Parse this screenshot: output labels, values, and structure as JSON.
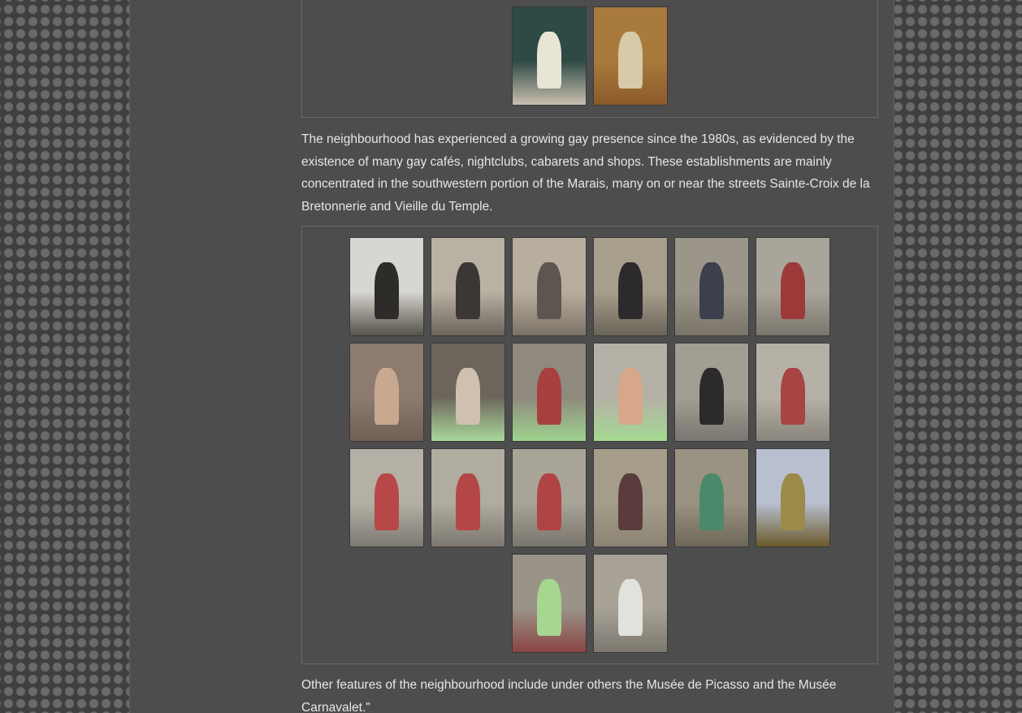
{
  "article": {
    "paragraph_1": "The neighbourhood has experienced a growing gay presence since the 1980s, as evidenced by the existence of many gay cafés, nightclubs, cabarets and shops. These establishments are mainly concentrated in the southwestern portion of the Marais, many on or near the streets Sainte-Croix de la Bretonnerie and Vieille du Temple.",
    "paragraph_2": "Other features of the neighbourhood include under others the Musée de Picasso and the Musée Carnavalet.\""
  },
  "colors": {
    "page_background": "#3f3f3f",
    "content_column": "#4d4d4d",
    "gallery_border": "#6b6b6b",
    "text": "#e6e6e6"
  },
  "gallery_top": {
    "thumbnails": [
      {
        "name": "pierrot-statue-thumbnail",
        "bg": "#2f4a45",
        "fg": "#e8e4d6",
        "floor": "#c9bfb0"
      },
      {
        "name": "harlequin-painting-thumbnail",
        "bg": "#a87a3c",
        "fg": "#d8c9a8",
        "floor": "#8c5a2a"
      }
    ]
  },
  "gallery_main": {
    "rows": [
      [
        {
          "name": "courtyard-photo-thumbnail",
          "bg": "#d8d6d0",
          "fg": "#2e2c2a",
          "floor": "#56524c"
        },
        {
          "name": "courtyard-photo-thumbnail",
          "bg": "#b9b1a3",
          "fg": "#3b3734",
          "floor": "#6d655c"
        },
        {
          "name": "courtyard-photo-thumbnail",
          "bg": "#b7ae9e",
          "fg": "#5c5550",
          "floor": "#7c7368"
        },
        {
          "name": "stained-window-photo-thumbnail",
          "bg": "#a79e8c",
          "fg": "#2c2a2c",
          "floor": "#6a6458"
        },
        {
          "name": "courtyard-photo-thumbnail",
          "bg": "#9c958a",
          "fg": "#3c3f4c",
          "floor": "#7a7468"
        },
        {
          "name": "girls-photo-thumbnail",
          "bg": "#aaa59a",
          "fg": "#9c3a3a",
          "floor": "#7b766c"
        }
      ],
      [
        {
          "name": "portrait-photo-thumbnail",
          "bg": "#8c7b6e",
          "fg": "#c9a890",
          "floor": "#6f5f55"
        },
        {
          "name": "portrait-photo-thumbnail",
          "bg": "#6d655c",
          "fg": "#cfc0b0",
          "floor": "#a8d89a"
        },
        {
          "name": "portrait-photo-thumbnail",
          "bg": "#8f897e",
          "fg": "#a84040",
          "floor": "#9ed38e"
        },
        {
          "name": "portrait-photo-thumbnail",
          "bg": "#b5b0a6",
          "fg": "#d6a889",
          "floor": "#a4da92"
        },
        {
          "name": "courtyard-photo-thumbnail",
          "bg": "#a39e94",
          "fg": "#2c2a2a",
          "floor": "#7a7670"
        },
        {
          "name": "girls-photo-thumbnail",
          "bg": "#b5b1a6",
          "fg": "#a84444",
          "floor": "#8a857c"
        }
      ],
      [
        {
          "name": "girls-photo-thumbnail",
          "bg": "#b4b0a5",
          "fg": "#b84848",
          "floor": "#7e7a72"
        },
        {
          "name": "girls-photo-thumbnail",
          "bg": "#b0aca0",
          "fg": "#b54646",
          "floor": "#7d786f"
        },
        {
          "name": "girls-photo-thumbnail",
          "bg": "#a9a498",
          "fg": "#b04444",
          "floor": "#7a756c"
        },
        {
          "name": "facade-photo-thumbnail",
          "bg": "#a59c8a",
          "fg": "#5a3c3c",
          "floor": "#8c8474"
        },
        {
          "name": "facade-photo-thumbnail",
          "bg": "#9a9282",
          "fg": "#4a8a6a",
          "floor": "#6e6858"
        },
        {
          "name": "building-sky-photo-thumbnail",
          "bg": "#b8c0d0",
          "fg": "#9c8a4a",
          "floor": "#6c5a2c"
        }
      ],
      [
        {
          "name": "group-photo-thumbnail",
          "bg": "#9a9488",
          "fg": "#a6d690",
          "floor": "#8a4444"
        },
        {
          "name": "group-photo-thumbnail",
          "bg": "#a8a296",
          "fg": "#e2e2dc",
          "floor": "#7c776e"
        }
      ]
    ]
  }
}
